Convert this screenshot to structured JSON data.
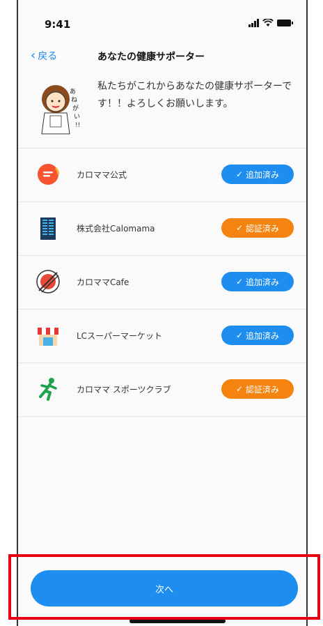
{
  "status": {
    "time": "9:41"
  },
  "nav": {
    "back_label": "戻る",
    "title": "あなたの健康サポーター"
  },
  "intro": {
    "text": "私たちがこれからあなたの健康サポーターです！！よろしくお願いします。"
  },
  "supporters": [
    {
      "name": "カロママ公式",
      "status": "追加済み",
      "status_color": "#1d8ef0",
      "icon": "calomama-chat-logo"
    },
    {
      "name": "株式会社Calomama",
      "status": "認証済み",
      "status_color": "#f5830f",
      "icon": "building-logo"
    },
    {
      "name": "カロママCafe",
      "status": "追加済み",
      "status_color": "#1d8ef0",
      "icon": "cafe-plate-logo"
    },
    {
      "name": "LCスーパーマーケット",
      "status": "追加済み",
      "status_color": "#1d8ef0",
      "icon": "store-awning-logo"
    },
    {
      "name": "カロママ スポーツクラブ",
      "status": "認証済み",
      "status_color": "#f5830f",
      "icon": "running-person-logo"
    }
  ],
  "footer": {
    "next_label": "次へ"
  },
  "colors": {
    "accent": "#1d8ef0",
    "verified": "#f5830f",
    "highlight": "#e60012"
  }
}
